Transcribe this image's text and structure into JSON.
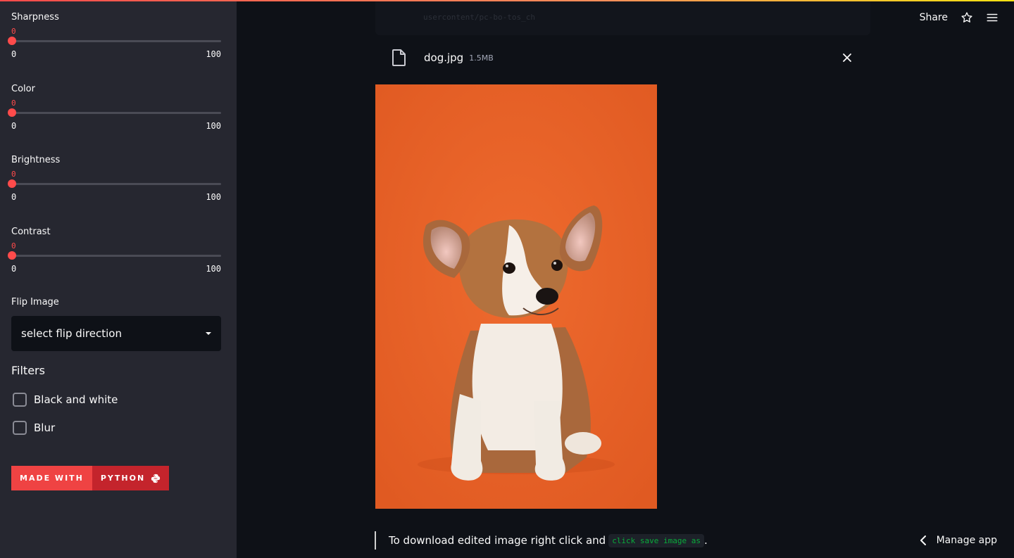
{
  "sidebar": {
    "sliders": [
      {
        "label": "Sharpness",
        "value": "0",
        "min": "0",
        "max": "100"
      },
      {
        "label": "Color",
        "value": "0",
        "min": "0",
        "max": "100"
      },
      {
        "label": "Brightness",
        "value": "0",
        "min": "0",
        "max": "100"
      },
      {
        "label": "Contrast",
        "value": "0",
        "min": "0",
        "max": "100"
      }
    ],
    "flip_label": "Flip Image",
    "flip_placeholder": "select flip direction",
    "filters_title": "Filters",
    "filters": [
      {
        "label": "Black and white"
      },
      {
        "label": "Blur"
      }
    ],
    "badge": {
      "left": "MADE WITH",
      "right": "PYTHON"
    }
  },
  "header": {
    "share": "Share",
    "faded_path": "usercontent/pc-bo-tos_ch"
  },
  "file": {
    "name": "dog.jpg",
    "size": "1.5MB"
  },
  "caption": {
    "text": "To download edited image right click and ",
    "code": "click save image as",
    "end": "."
  },
  "footer": {
    "manage": "Manage app"
  },
  "colors": {
    "accent": "#ff4b4b",
    "bg": "#0e1117",
    "sidebar": "#262730",
    "code": "#09ab3b"
  }
}
